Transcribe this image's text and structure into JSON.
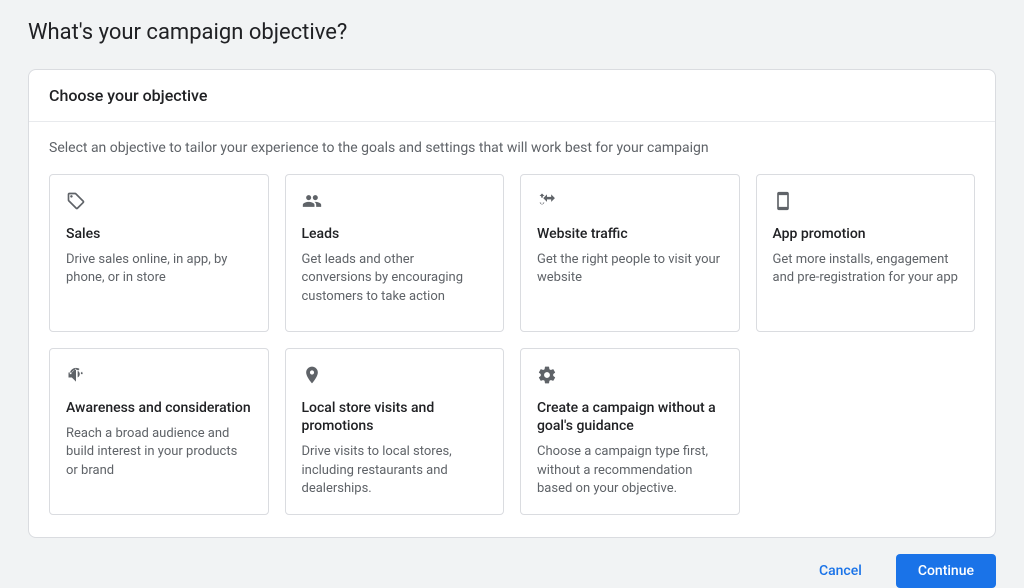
{
  "page": {
    "title": "What's your campaign objective?"
  },
  "panel": {
    "heading": "Choose your objective",
    "subtitle": "Select an objective to tailor your experience to the goals and settings that will work best for your campaign"
  },
  "objectives": [
    {
      "title": "Sales",
      "desc": "Drive sales online, in app, by phone, or in store",
      "icon": "<svg viewBox='0 0 24 24' class='objective-icon'><path d='M21.41 11.58l-9-9C12.05 2.22 11.55 2 11 2H4c-1.1 0-2 .9-2 2v7c0 .55.22 1.05.59 1.42l9 9c.36.36.86.58 1.41.58.55 0 1.05-.22 1.41-.59l7-7c.37-.36.59-.86.59-1.41 0-.55-.23-1.06-.59-1.42zM13 20.01L4 11V4h7v-.01l9 9-7 7.02zM6.5 8C7.33 8 8 7.33 8 6.5S7.33 5 6.5 5 5 5.67 5 6.5 5.67 8 6.5 8z'/></svg>"
    },
    {
      "title": "Leads",
      "desc": "Get leads and other conversions by encouraging customers to take action",
      "icon": "<svg viewBox='0 0 24 24' class='objective-icon'><path d='M16 11c1.66 0 2.99-1.34 2.99-3S17.66 5 16 5s-3 1.34-3 3 1.34 3 3 3zm-8 0c1.66 0 2.99-1.34 2.99-3S9.66 5 8 5 5 6.34 5 8s1.34 3 3 3zm0 2c-2.33 0-7 1.17-7 3.5V19h14v-2.5c0-2.33-4.67-3.5-7-3.5zm8 0c-.29 0-.62.02-.97.05 1.16.84 1.97 1.97 1.97 3.45V19h6v-2.5c0-2.33-4.67-3.5-7-3.5z'/></svg>"
    },
    {
      "title": "Website traffic",
      "desc": "Get the right people to visit your website",
      "icon": "<svg viewBox='0 0 24 24' class='objective-icon'><path d='M17 4v3h-5V4l-4.5 4.5L12 13v-3h5v3l4.5-4.5L17 4zM7 6v2H5V6H3l3-3 3 3H7zm-4 8h2v2h2v-2h2l-3 3-3-3z'/></svg>"
    },
    {
      "title": "App promotion",
      "desc": "Get more installs, engagement and pre-registration for your app",
      "icon": "<svg viewBox='0 0 24 24' class='objective-icon'><path d='M17 1.01L7 1c-1.1 0-2 .9-2 2v18c0 1.1.9 2 2 2h10c1.1 0 2-.9 2-2V3c0-1.1-.9-1.99-2-1.99zM17 19H7V5h10v14z'/></svg>"
    },
    {
      "title": "Awareness and consideration",
      "desc": "Reach a broad audience and build interest in your products or brand",
      "icon": "<svg viewBox='0 0 24 24' class='objective-icon'><path d='M18 11c0-.56-.1-1.1-.27-1.6l1.5-1.5C19.73 8.89 20 9.91 20 11h-2zm-1.94-5.88l-1.41 1.41C13.87 5.87 12.97 5.5 12 5.5c-3.03 0-5.5 2.47-5.5 5.5h-2c0-4.14 3.36-7.5 7.5-7.5 1.52 0 2.93.46 4.06 1.12zM3 9v6h4l5 5V4L7 9H3zm13.5 2c0-1.77-1.02-3.29-2.5-4.03v8.05c1.48-.73 2.5-2.25 2.5-4.02z'/></svg>"
    },
    {
      "title": "Local store visits and promotions",
      "desc": "Drive visits to local stores, including restaurants and dealerships.",
      "icon": "<svg viewBox='0 0 24 24' class='objective-icon'><path d='M12 2C8.13 2 5 5.13 5 9c0 5.25 7 13 7 13s7-7.75 7-13c0-3.87-3.13-7-7-7zm0 9.5c-1.38 0-2.5-1.12-2.5-2.5s1.12-2.5 2.5-2.5 2.5 1.12 2.5 2.5-1.12 2.5-2.5 2.5z'/></svg>"
    },
    {
      "title": "Create a campaign without a goal's guidance",
      "desc": "Choose a campaign type first, without a recommendation based on your objective.",
      "icon": "<svg viewBox='0 0 24 24' class='objective-icon'><path d='M19.43 12.98c.04-.32.07-.64.07-.98s-.03-.66-.07-.98l2.11-1.65c.19-.15.24-.42.12-.64l-2-3.46c-.12-.22-.39-.3-.61-.22l-2.49 1c-.52-.4-1.08-.73-1.69-.98l-.38-2.65C14.46 2.18 14.25 2 14 2h-4c-.25 0-.46.18-.49.42l-.38 2.65c-.61.25-1.17.59-1.69.98l-2.49-1c-.23-.09-.49 0-.61.22l-2 3.46c-.13.22-.07.49.12.64l2.11 1.65c-.04.32-.07.65-.07.98s.03.66.07.98l-2.11 1.65c-.19.15-.24.42-.12.64l2 3.46c.12.22.39.3.61.22l2.49-1c.52.4 1.08.73 1.69.98l.38 2.65c.03.24.24.42.49.42h4c.25 0 .46-.18.49-.42l.38-2.65c.61-.25 1.17-.59 1.69-.98l2.49 1c.23.09.49 0 .61-.22l2-3.46c.12-.22.07-.49-.12-.64l-2.11-1.65zM12 15.5c-1.93 0-3.5-1.57-3.5-3.5s1.57-3.5 3.5-3.5 3.5 1.57 3.5 3.5-1.57 3.5-3.5 3.5z'/></svg>"
    }
  ],
  "footer": {
    "cancel": "Cancel",
    "continue": "Continue"
  }
}
